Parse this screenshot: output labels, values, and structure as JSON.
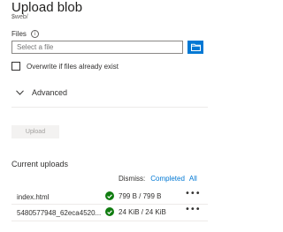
{
  "header": {
    "title": "Upload blob",
    "subtitle": "$web/"
  },
  "files": {
    "label": "Files",
    "placeholder": "Select a file"
  },
  "overwrite": {
    "label": "Overwrite if files already exist",
    "checked": false
  },
  "advanced": {
    "label": "Advanced"
  },
  "upload_button": {
    "label": "Upload",
    "enabled": false
  },
  "current_uploads": {
    "heading": "Current uploads",
    "dismiss_label": "Dismiss:",
    "dismiss_completed": "Completed",
    "dismiss_all": "All",
    "items": [
      {
        "name": "index.html",
        "status": "799 B / 799 B",
        "more": "•••"
      },
      {
        "name": "5480577948_62eca4520...",
        "status": "24 KiB / 24 KiB",
        "more": "•••"
      }
    ]
  },
  "colors": {
    "accent": "#0078d4",
    "success": "#107c10"
  },
  "icons": [
    "info-icon",
    "folder-icon",
    "chevron-down-icon",
    "check-circle-icon",
    "more-icon"
  ]
}
